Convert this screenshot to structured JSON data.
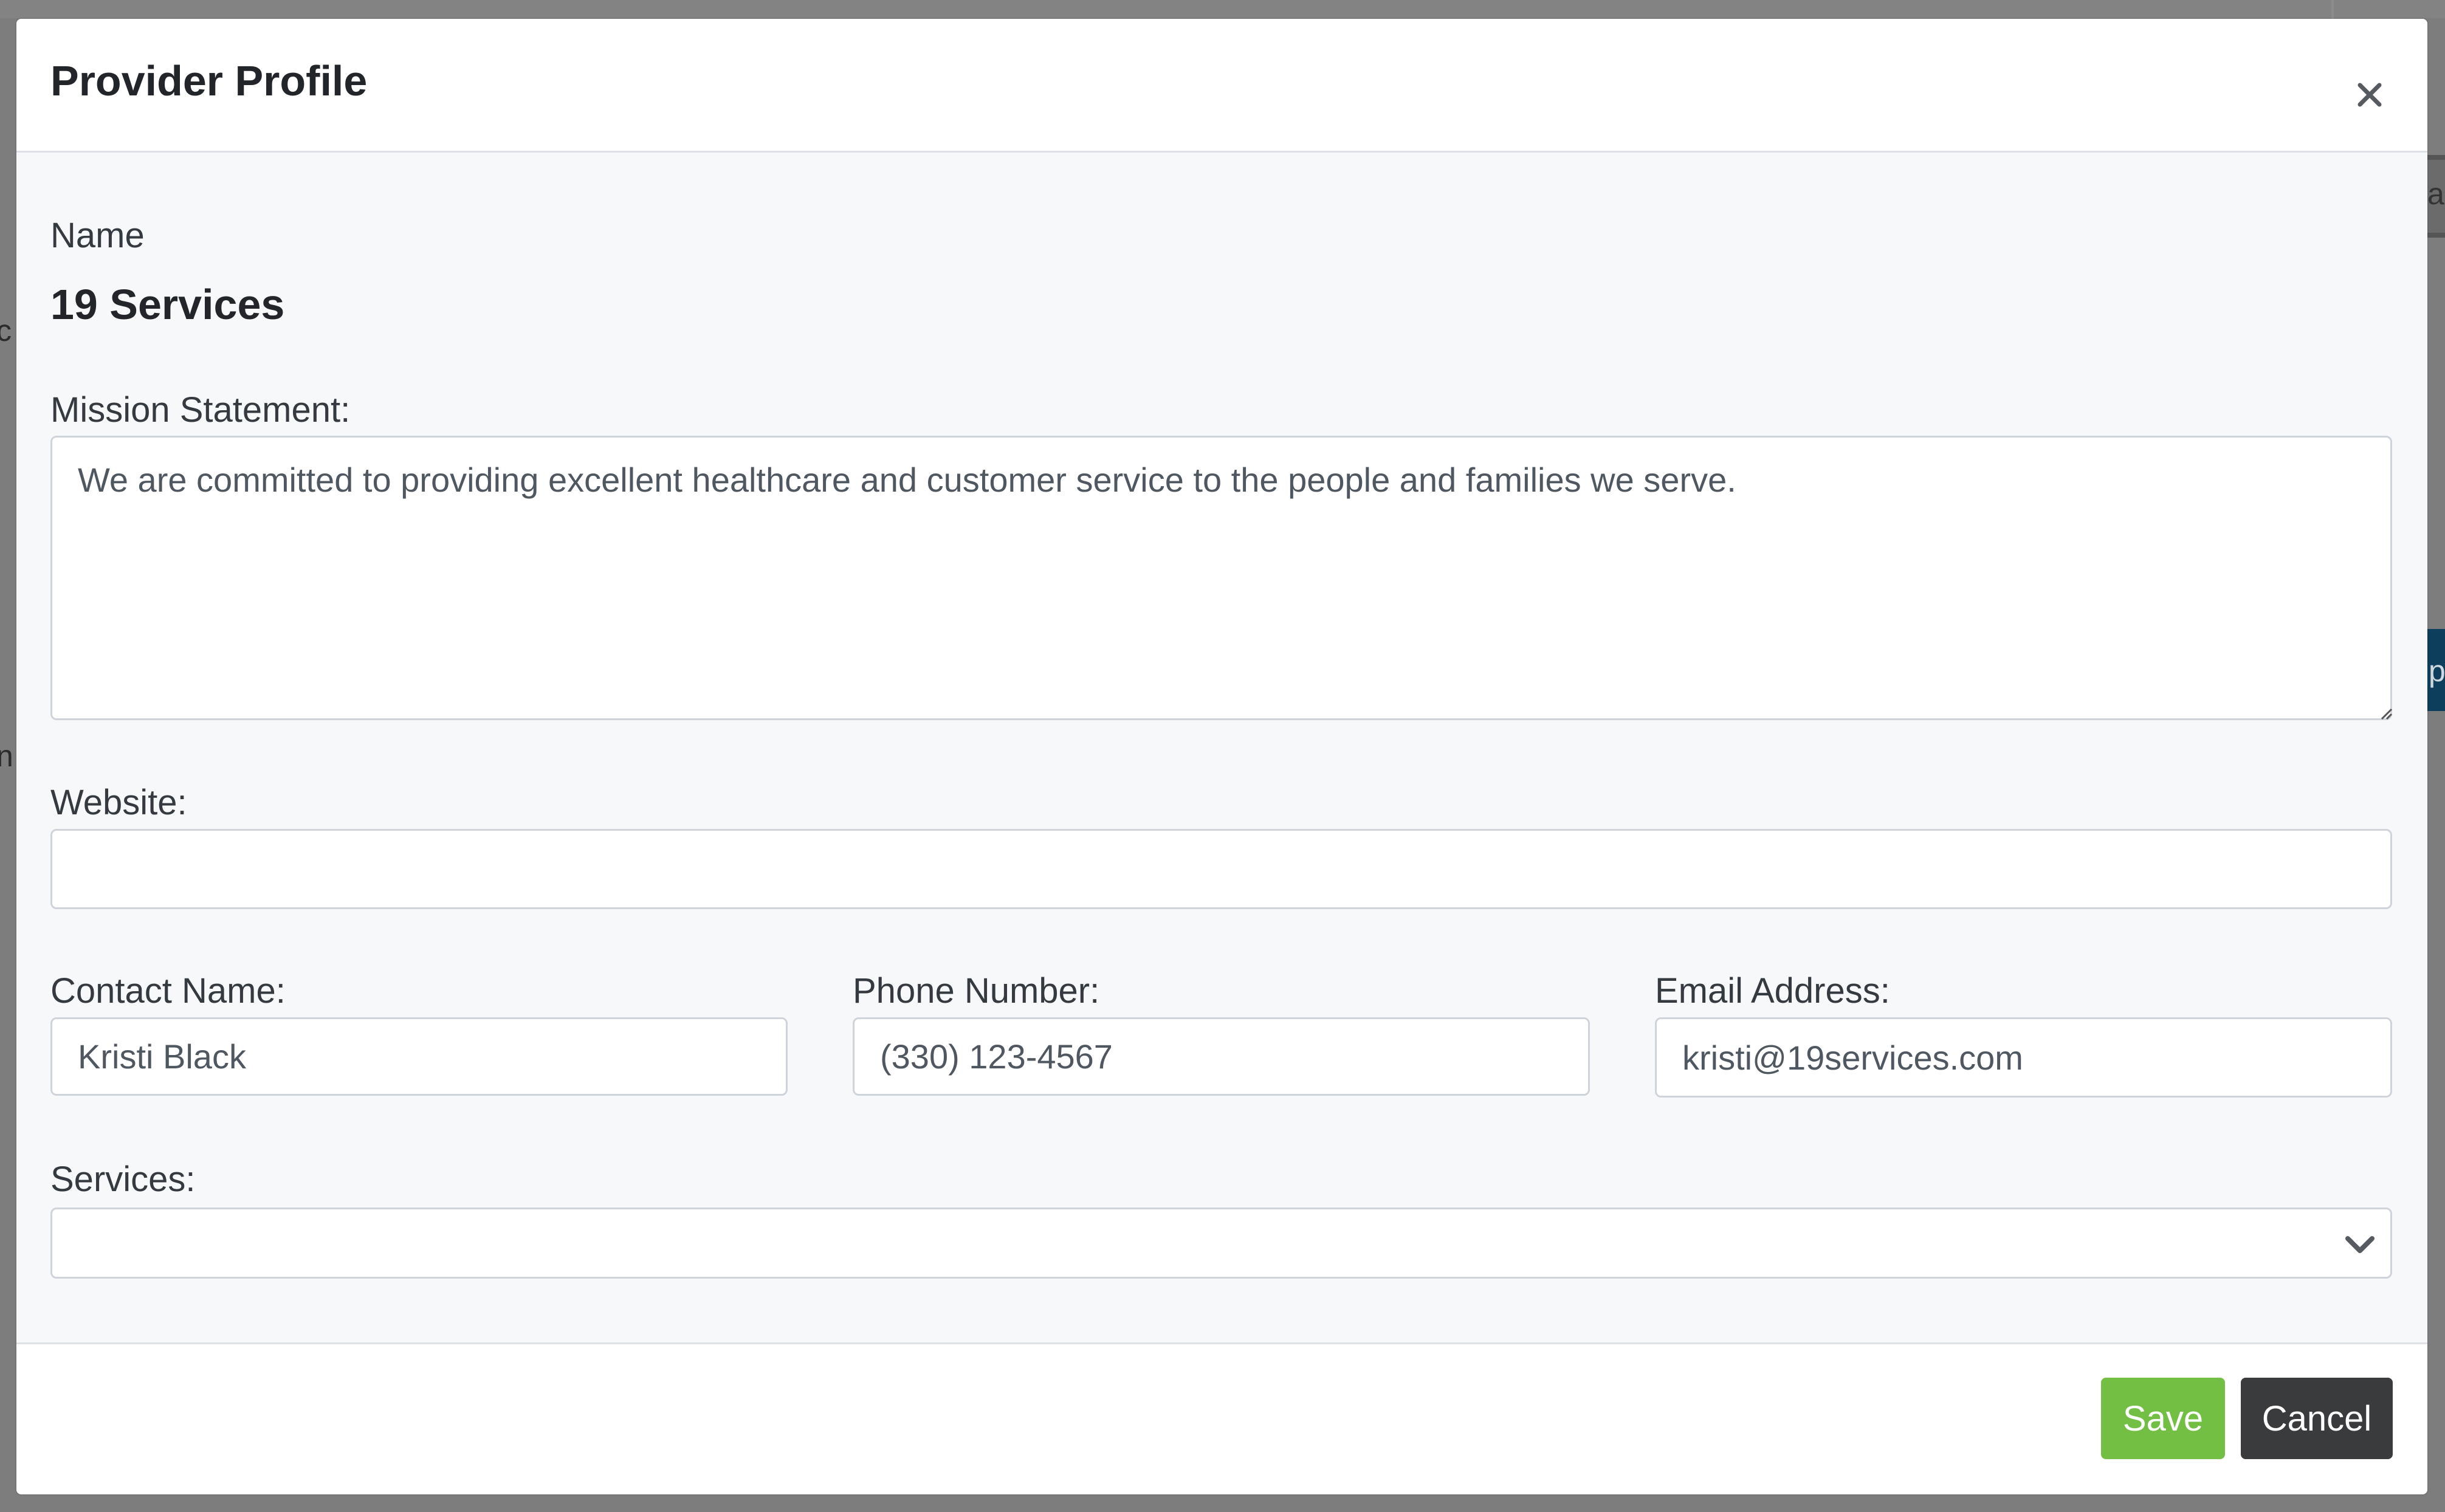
{
  "background": {
    "fragments": [
      "c",
      "n",
      "a",
      "p"
    ]
  },
  "modal": {
    "title": "Provider Profile",
    "close_icon": "close-icon"
  },
  "form": {
    "name_label": "Name",
    "name_value": "19 Services",
    "mission_label": "Mission Statement:",
    "mission_value": "We are committed to providing excellent healthcare and customer service to the people and families we serve.",
    "website_label": "Website:",
    "website_value": "",
    "contact_label": "Contact Name:",
    "contact_value": "Kristi Black",
    "phone_label": "Phone Number:",
    "phone_value": "(330) 123-4567",
    "email_label": "Email Address:",
    "email_value": "kristi@19services.com",
    "services_label": "Services:",
    "services_value": "",
    "services_icon": "chevron-down-icon"
  },
  "footer": {
    "save_label": "Save",
    "cancel_label": "Cancel"
  },
  "colors": {
    "save": "#72bf44",
    "cancel": "#3a3b3c",
    "overlay": "#7d7d7d",
    "modal_body": "#f7f8fa"
  }
}
